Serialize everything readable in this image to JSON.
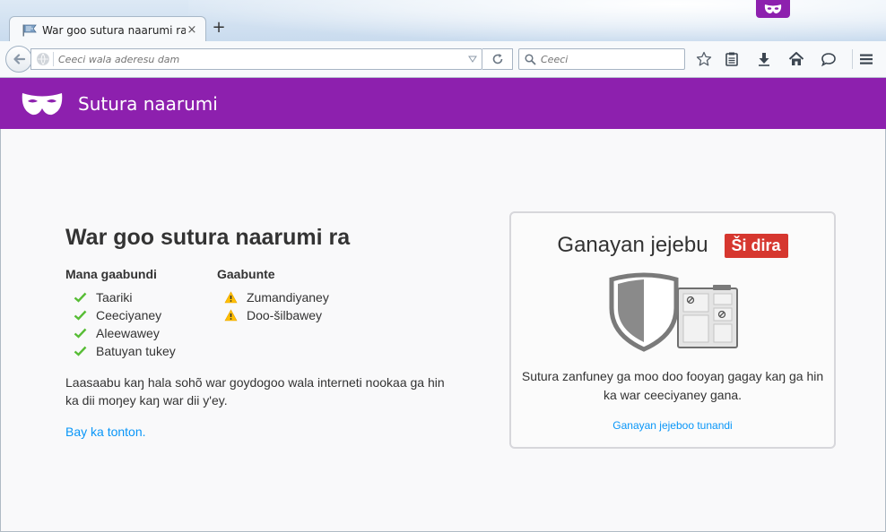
{
  "window": {
    "tab_title": "War goo sutura naarumi ra",
    "new_tab_label": "+",
    "close_label": "×"
  },
  "navbar": {
    "url_placeholder": "Ceeci wala aderesu dam",
    "search_placeholder": "Ceeci"
  },
  "header": {
    "title": "Sutura naarumi",
    "accent_color": "#8d20ae"
  },
  "main": {
    "heading": "War goo sutura naarumi ra",
    "saved": {
      "heading": "Mana gaabundi",
      "items": [
        "Taariki",
        "Ceeciyaney",
        "Aleewawey",
        "Batuyan tukey"
      ]
    },
    "kept": {
      "heading": "Gaabunte",
      "items": [
        "Zumandiyaney",
        "Doo-šilbawey"
      ]
    },
    "description": "Laasaabu kaŋ hala sohõ war goydogoo wala interneti nookaa ga hin ka dii moŋey kaŋ war dii y'ey.",
    "learn_more": "Bay ka tonton."
  },
  "tracking_protection": {
    "title": "Ganayan jejebu",
    "status": "Ši dira",
    "status_color": "#d6372f",
    "description": "Sutura zanfuney ga moo doo fooyaŋ gagay kaŋ ga hin ka war ceeciyaney gana.",
    "link": "Ganayan jejeboo tunandi"
  },
  "icons": {
    "tab_favicon": "private-page-favicon",
    "back": "back-arrow-icon",
    "reload": "reload-icon",
    "search": "search-icon",
    "bookmark": "star-icon",
    "reading_list": "clipboard-icon",
    "downloads": "download-arrow-icon",
    "home": "home-icon",
    "chat": "speech-bubble-icon",
    "menu": "hamburger-menu-icon",
    "saved_item": "check-icon",
    "kept_item": "warning-icon"
  }
}
